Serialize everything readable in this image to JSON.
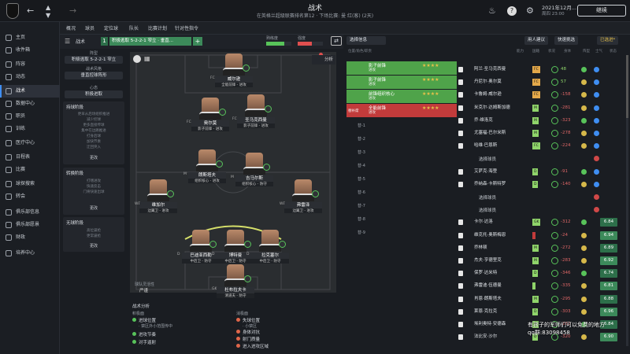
{
  "topbar": {
    "title": "战术",
    "subtitle": "在英格兰超级联赛排名第12 · 下场比赛: 曼 红(客) (2天)",
    "date": "2021年12月...",
    "date_sub": "周四 23:00",
    "continue": "继续"
  },
  "sidebar": {
    "items": [
      {
        "label": "主页"
      },
      {
        "label": "收件箱"
      },
      {
        "label": "阵容"
      },
      {
        "label": "动态"
      },
      {
        "label": "战术"
      },
      {
        "label": "数据中心"
      },
      {
        "label": "职员"
      },
      {
        "label": "训练"
      },
      {
        "label": "医疗中心"
      },
      {
        "label": "日程表"
      },
      {
        "label": "比赛"
      },
      {
        "label": "球探搜索"
      },
      {
        "label": "转会"
      },
      {
        "label": "俱乐部信息"
      },
      {
        "label": "俱乐部愿景"
      },
      {
        "label": "财政"
      },
      {
        "label": "培养中心"
      }
    ]
  },
  "subnav": {
    "items": [
      "概况",
      "球员",
      "定位球",
      "队长",
      "比赛计划",
      "针对性指令"
    ]
  },
  "tactics_header": {
    "label": "战术",
    "number": "1",
    "tactic": "积极逃取 5-2-2-1 窄立 · 垂直...",
    "plus": "+",
    "familiarity_label": "熟练度",
    "intensity_label": "强度",
    "familiarity": 0.72,
    "intensity": 0.55
  },
  "left_panel": {
    "preset_label": "阵型",
    "preset_value": "积极逃取 5-2-2-1 窄立",
    "style_label": "战术风格",
    "style_value": "垂直控球阵形",
    "mentality_label": "心态",
    "mentality_value": "积极进取",
    "cards": [
      {
        "title": "持球阶段",
        "lines": [
          "更早从后场组织推进",
          "减少控球",
          "更多直接传球",
          "集中在边路推进",
          "打身后球",
          "加快节奏",
          "迂回突入"
        ],
        "edit": "更改"
      },
      {
        "title": "转换阶段",
        "lines": [
          "打嗜进攻",
          "快速反击",
          "门将快速出球"
        ],
        "edit": "更改"
      },
      {
        "title": "无球阶段",
        "lines": [
          "高位逼抢",
          "更常逼抢"
        ],
        "edit": "更改"
      }
    ]
  },
  "pitch": {
    "analysis": "分析",
    "players": [
      {
        "name": "威尔逊",
        "role": "全能前锋 - 进攻",
        "pos": "FC"
      },
      {
        "name": "圣马克西曼",
        "role": "影子前锋 - 进攻",
        "pos": "FC"
      },
      {
        "name": "奥尔莫",
        "role": "影子前锋 - 进攻",
        "pos": "FC"
      },
      {
        "name": "朗斯塔夫",
        "role": "组织核心 - 进攻",
        "pos": "M"
      },
      {
        "name": "吉马尔斯",
        "role": "组织核心 - 防守",
        "pos": "M"
      },
      {
        "name": "维加尔",
        "role": "边翼卫 - 进攻",
        "pos": "WB"
      },
      {
        "name": "弗雷泽",
        "role": "边翼卫 - 进攻",
        "pos": "WB"
      },
      {
        "name": "巴迪亚西勒",
        "role": "中后卫 - 防守",
        "pos": "D"
      },
      {
        "name": "博特曼",
        "role": "中后卫 - 防守",
        "pos": "D"
      },
      {
        "name": "拉克塞尔",
        "role": "中后卫 - 防守",
        "pos": "D"
      },
      {
        "name": "杜布拉夫卡",
        "role": "清道夫 - 防守",
        "pos": "GK"
      }
    ],
    "team_stance_label": "球队灵活性",
    "team_stance_value": "严谨"
  },
  "analysis": {
    "title": "战术分析",
    "strengths_label": "积极面",
    "weaknesses_label": "消极面",
    "strengths": [
      "进球位置",
      "进攻节奏",
      "对手逼射"
    ],
    "strengths_sub": [
      "· 禁区外小范围传中"
    ],
    "weaknesses": [
      "失球位置",
      "身体对抗",
      "射门质量",
      "进入进攻区域"
    ],
    "weaknesses_sub": [
      "· 小禁区"
    ]
  },
  "right_panel": {
    "buttons": [
      "选择信息",
      "用人建议",
      "快速挑选",
      "已选进*"
    ],
    "col_heads": [
      "位置/角色/职责",
      "能力",
      "国籍",
      "状况",
      "身体",
      "阵型",
      "士气",
      "状态"
    ],
    "slots": [
      {
        "code": "",
        "role": "影子前锋",
        "duty": "进攻",
        "stars": "★★★★",
        "color": "#4fa34a"
      },
      {
        "code": "",
        "role": "影子前锋",
        "duty": "进攻",
        "stars": "★★★★",
        "color": "#4fa34a"
      },
      {
        "code": "",
        "role": "前锋组织核心",
        "duty": "进攻",
        "stars": "★★★★",
        "color": "#4fa34a"
      },
      {
        "code": "",
        "role": "全能前锋",
        "duty": "进攻",
        "stars": "★★★★",
        "color": "#c23b3b"
      },
      {
        "code": "替补席",
        "role": "",
        "duty": "",
        "stars": "",
        "color": ""
      }
    ],
    "sub_slots": [
      "替-1",
      "替-2",
      "替-3",
      "替-4",
      "替-5",
      "替-6",
      "替-7",
      "替-8",
      "替-9"
    ],
    "players": [
      {
        "name": "阿兰·圣马克西曼",
        "pos": "FC",
        "val": "48",
        "rating": "",
        "pcol": "#e3a84a"
      },
      {
        "name": "丹尼尔·奥尔莫",
        "pos": "FC",
        "val": "57",
        "rating": "",
        "pcol": "#e3a84a"
      },
      {
        "name": "卡鲁姆·威尔逊",
        "pos": "FC",
        "val": "-158",
        "rating": "",
        "pcol": "#e3a84a"
      },
      {
        "name": "米克尔·达姆斯加德",
        "pos": "M",
        "val": "-281",
        "rating": "",
        "pcol": "#8fd46a"
      },
      {
        "name": "乔·维洛克",
        "pos": "M",
        "val": "-323",
        "rating": "",
        "pcol": "#8fd46a"
      },
      {
        "name": "尤塞福·巴尔米斯",
        "pos": "M",
        "val": "-278",
        "rating": "",
        "pcol": "#8fd46a"
      },
      {
        "name": "哈维·巴恩斯",
        "pos": "FC",
        "val": "-224",
        "rating": "",
        "pcol": "#8fd46a"
      },
      {
        "name": "选择球员",
        "pos": "",
        "val": "",
        "rating": "",
        "pcol": ""
      },
      {
        "name": "艾萨克·海登",
        "pos": "D",
        "val": "-91",
        "rating": "",
        "pcol": "#8fd46a"
      },
      {
        "name": "乔纳森·卡斯特罗",
        "pos": "D",
        "val": "-140",
        "rating": "",
        "pcol": "#8fd46a"
      },
      {
        "name": "选择球员",
        "pos": "",
        "val": "",
        "rating": "",
        "pcol": ""
      },
      {
        "name": "选择球员",
        "pos": "",
        "val": "",
        "rating": "",
        "pcol": ""
      },
      {
        "name": "卡尔·达洛",
        "pos": "GK",
        "val": "-312",
        "rating": "6.84",
        "pcol": "#8fd46a"
      },
      {
        "name": "维克托·奥斯梅恩",
        "pos": "",
        "val": "-24",
        "rating": "6.94",
        "pcol": "#c23b3b"
      },
      {
        "name": "乔林顿",
        "pos": "M",
        "val": "-272",
        "rating": "6.89",
        "pcol": "#8fd46a"
      },
      {
        "name": "杰夫·亨德里克",
        "pos": "M",
        "val": "-283",
        "rating": "6.92",
        "pcol": "#8fd46a"
      },
      {
        "name": "保罗·达米特",
        "pos": "D",
        "val": "-346",
        "rating": "6.74",
        "pcol": "#8fd46a"
      },
      {
        "name": "弗雷迪·伍德曼",
        "pos": "",
        "val": "-335",
        "rating": "6.81",
        "pcol": "#8fd46a"
      },
      {
        "name": "肖恩·朗斯塔夫",
        "pos": "M",
        "val": "-295",
        "rating": "6.88",
        "pcol": "#8fd46a"
      },
      {
        "name": "莱恩·克拉克",
        "pos": "D",
        "val": "-303",
        "rating": "6.96",
        "pcol": "#8fd46a"
      },
      {
        "name": "埃利奥特·安德森",
        "pos": "M",
        "val": "-282",
        "rating": "6.84",
        "pcol": "#8fd46a"
      },
      {
        "name": "法比安·沙尔",
        "pos": "D",
        "val": "-320",
        "rating": "6.90",
        "pcol": "#8fd46a"
      }
    ]
  },
  "overlay": {
    "line1": "有孩子的军师们可以免费的地方",
    "line2": "qq群:83098458"
  }
}
